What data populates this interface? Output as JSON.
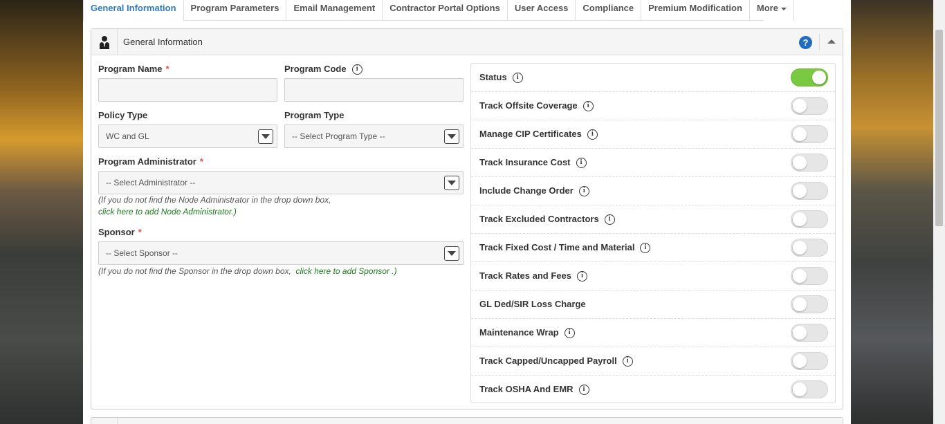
{
  "tabs": [
    {
      "label": "General Information",
      "active": true
    },
    {
      "label": "Program Parameters"
    },
    {
      "label": "Email Management"
    },
    {
      "label": "Contractor Portal Options"
    },
    {
      "label": "User Access"
    },
    {
      "label": "Compliance"
    },
    {
      "label": "Premium Modification"
    },
    {
      "label": "More"
    }
  ],
  "panel": {
    "title": "General Information",
    "icon": "user-tie-icon",
    "help": "?"
  },
  "form": {
    "program_name": {
      "label": "Program Name",
      "required": "*",
      "value": ""
    },
    "program_code": {
      "label": "Program Code",
      "value": ""
    },
    "policy_type": {
      "label": "Policy Type",
      "value": "WC and GL"
    },
    "program_type": {
      "label": "Program Type",
      "value": "-- Select Program Type --"
    },
    "program_administrator": {
      "label": "Program Administrator",
      "required": "*",
      "value": "-- Select Administrator --",
      "note_line1": "(If you do not find the Node Administrator in the drop down box,",
      "note_link": "click here to add Node Administrator.)"
    },
    "sponsor": {
      "label": "Sponsor",
      "required": "*",
      "value": "-- Select Sponsor --",
      "note_text": "(If you do not find the Sponsor in the drop down box,",
      "note_link": "click here to add Sponsor .)"
    }
  },
  "toggles": [
    {
      "label": "Status",
      "info": true,
      "on": true
    },
    {
      "label": "Track Offsite Coverage",
      "info": true,
      "on": false
    },
    {
      "label": "Manage CIP Certificates",
      "info": true,
      "on": false
    },
    {
      "label": "Track Insurance Cost",
      "info": true,
      "on": false
    },
    {
      "label": "Include Change Order",
      "info": true,
      "on": false
    },
    {
      "label": "Track Excluded Contractors",
      "info": true,
      "on": false
    },
    {
      "label": "Track Fixed Cost / Time and Material",
      "info": true,
      "on": false
    },
    {
      "label": "Track Rates and Fees",
      "info": true,
      "on": false
    },
    {
      "label": "GL Ded/SIR Loss Charge",
      "info": false,
      "on": false
    },
    {
      "label": "Maintenance Wrap",
      "info": true,
      "on": false
    },
    {
      "label": "Track Capped/Uncapped Payroll",
      "info": true,
      "on": false
    },
    {
      "label": "Track OSHA And EMR",
      "info": true,
      "on": false
    }
  ],
  "colors": {
    "accent": "#2f7ac0",
    "toggle_on": "#7ac943",
    "link": "#1e7a1e",
    "required": "#d9534f",
    "help": "#1f6cc0"
  }
}
